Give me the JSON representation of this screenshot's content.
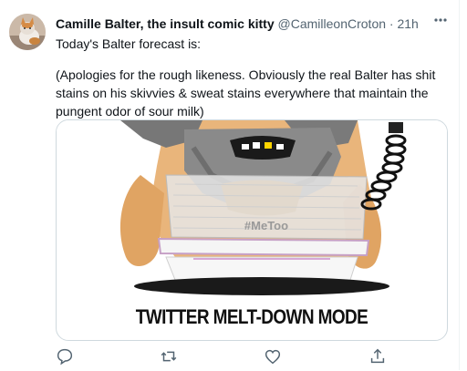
{
  "tweet": {
    "author_name": "Camille Balter, the insult comic kitty",
    "handle": "@CamilleonCroton",
    "separator": "·",
    "time": "21h",
    "text_line1": "Today's Balter forecast  is:",
    "text_para2": "(Apologies for the rough likeness. Obviously the real Balter has shit stains on his skivvies & sweat stains everywhere that maintain the pungent odor of sour milk)"
  },
  "media": {
    "shirt_text": "#MeToo",
    "caption": "TWITTER MELT-DOWN MODE"
  },
  "icons": {
    "more": "more-icon",
    "reply": "reply-icon",
    "retweet": "retweet-icon",
    "like": "like-icon",
    "share": "share-icon"
  },
  "colors": {
    "text": "#0f1419",
    "secondary": "#536471",
    "border": "#cfd9de",
    "icon": "#536471"
  }
}
